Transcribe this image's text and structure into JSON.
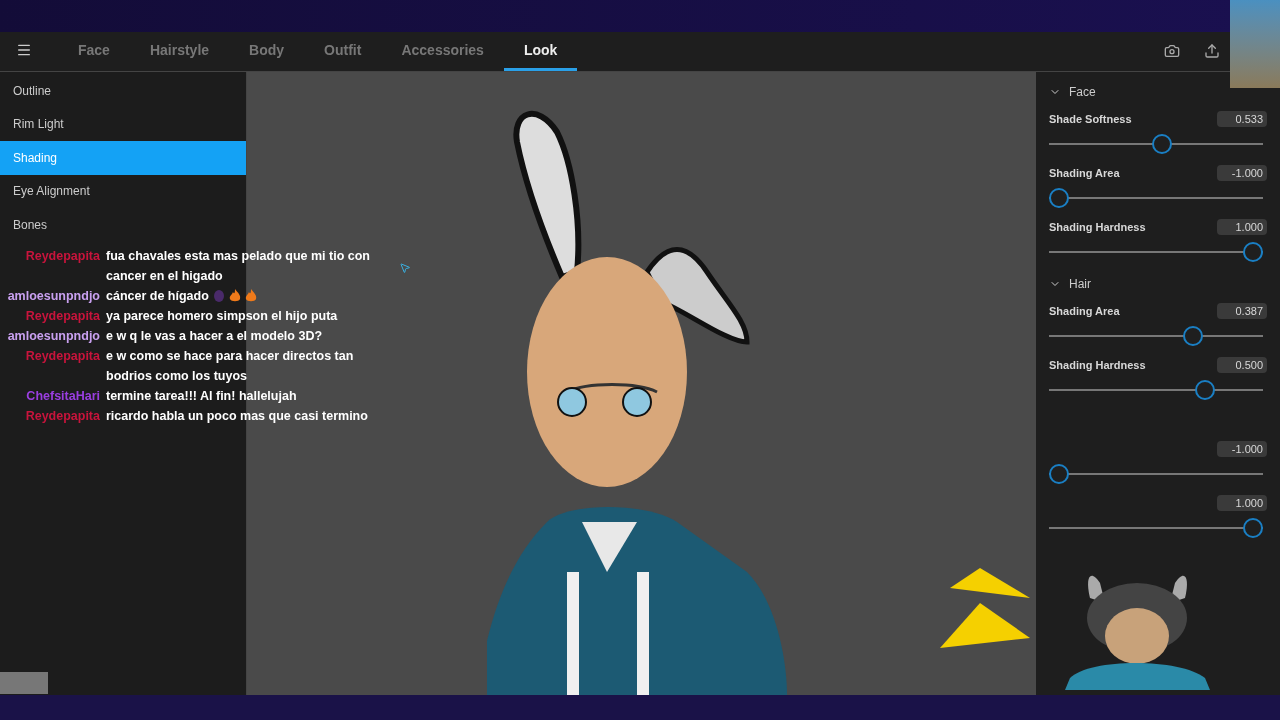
{
  "tabs": [
    {
      "label": "Face",
      "selected": false
    },
    {
      "label": "Hairstyle",
      "selected": false
    },
    {
      "label": "Body",
      "selected": false
    },
    {
      "label": "Outfit",
      "selected": false
    },
    {
      "label": "Accessories",
      "selected": false
    },
    {
      "label": "Look",
      "selected": true
    }
  ],
  "sidebar": {
    "items": [
      {
        "label": "Outline",
        "selected": false
      },
      {
        "label": "Rim Light",
        "selected": false
      },
      {
        "label": "Shading",
        "selected": true
      },
      {
        "label": "Eye Alignment",
        "selected": false
      },
      {
        "label": "Bones",
        "selected": false
      }
    ]
  },
  "chat": [
    {
      "user": "Reydepapita",
      "color": "#c8143c",
      "message": "fua chavales esta mas pelado que mi tio con cancer en el higado"
    },
    {
      "user": "amloesunpndjo",
      "color": "#c9a0f0",
      "message": "cáncer de hígado",
      "with_emotes": true
    },
    {
      "user": "Reydepapita",
      "color": "#c8143c",
      "message": "ya parece homero simpson el hijo puta"
    },
    {
      "user": "amloesunpndjo",
      "color": "#c9a0f0",
      "message": "e w q le vas a hacer a el modelo 3D?"
    },
    {
      "user": "Reydepapita",
      "color": "#c8143c",
      "message": "e w como se hace para hacer directos tan bodrios como los tuyos"
    },
    {
      "user": "ChefsitaHari",
      "color": "#9a3ee0",
      "message": "termine tarea!!! Al fin! hallelujah"
    },
    {
      "user": "Reydepapita",
      "color": "#c8143c",
      "message": "ricardo habla un poco mas que casi termino"
    }
  ],
  "panel": {
    "sections": [
      {
        "title": "Face",
        "expanded": true,
        "sliders": [
          {
            "label": "Shade Softness",
            "value": "0.533",
            "level": 0.53
          },
          {
            "label": "Shading Area",
            "value": "-1.000",
            "level": 0
          },
          {
            "label": "Shading Hardness",
            "value": "1.000",
            "level": 1
          }
        ]
      },
      {
        "title": "Hair",
        "expanded": true,
        "sliders": [
          {
            "label": "Shading Area",
            "value": "0.387",
            "level": 0.69
          },
          {
            "label": "Shading Hardness",
            "value": "0.500",
            "level": 0.75
          }
        ]
      },
      {
        "sliders": [
          {
            "value": "-1.000",
            "level": 0
          },
          {
            "value": "1.000",
            "level": 1
          }
        ]
      }
    ]
  }
}
